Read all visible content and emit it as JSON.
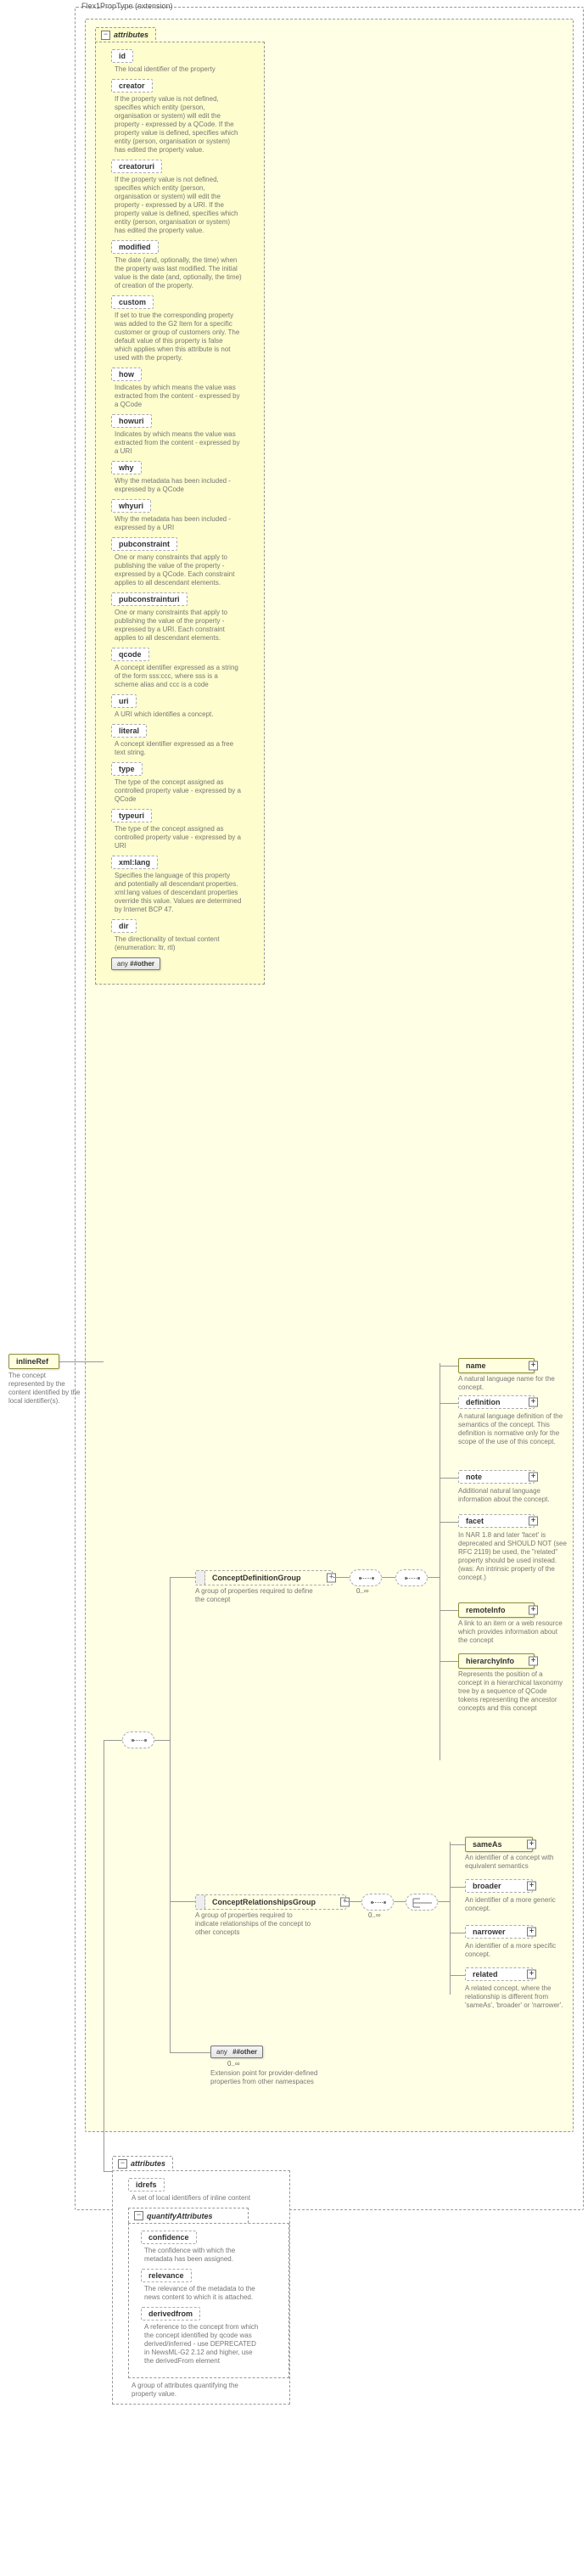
{
  "outer": {
    "extension_label": "Flex1PropType (extension)",
    "inlineRef": {
      "name": "inlineRef",
      "desc": "The concept represented by the content identified by the local identifier(s)."
    }
  },
  "attrs_main": {
    "header": "attributes",
    "items": [
      {
        "name": "id",
        "desc": "The local identifier of the property"
      },
      {
        "name": "creator",
        "desc": "If the property value is not defined, specifies which entity (person, organisation or system) will edit the property - expressed by a QCode. If the property value is defined, specifies which entity (person, organisation or system) has edited the property value."
      },
      {
        "name": "creatoruri",
        "desc": "If the property value is not defined, specifies which entity (person, organisation or system) will edit the property - expressed by a URI. If the property value is defined, specifies which entity (person, organisation or system) has edited the property value."
      },
      {
        "name": "modified",
        "desc": "The date (and, optionally, the time) when the property was last modified. The initial value is the date (and, optionally, the time) of creation of the property."
      },
      {
        "name": "custom",
        "desc": "If set to true the corresponding property was added to the G2 Item for a specific customer or group of customers only. The default value of this property is false which applies when this attribute is not used with the property."
      },
      {
        "name": "how",
        "desc": "Indicates by which means the value was extracted from the content - expressed by a QCode"
      },
      {
        "name": "howuri",
        "desc": "Indicates by which means the value was extracted from the content - expressed by a URI"
      },
      {
        "name": "why",
        "desc": "Why the metadata has been included - expressed by a QCode"
      },
      {
        "name": "whyuri",
        "desc": "Why the metadata has been included - expressed by a URI"
      },
      {
        "name": "pubconstraint",
        "desc": "One or many constraints that apply to publishing the value of the property - expressed by a QCode. Each constraint applies to all descendant elements."
      },
      {
        "name": "pubconstrainturi",
        "desc": "One or many constraints that apply to publishing the value of the property - expressed by a URI. Each constraint applies to all descendant elements."
      },
      {
        "name": "qcode",
        "desc": "A concept identifier expressed as a string of the form sss:ccc, where sss is a scheme alias and ccc is a code"
      },
      {
        "name": "uri",
        "desc": "A URI which identifies a concept."
      },
      {
        "name": "literal",
        "desc": "A concept identifier expressed as a free text string."
      },
      {
        "name": "type",
        "desc": "The type of the concept assigned as controlled property value - expressed by a QCode"
      },
      {
        "name": "typeuri",
        "desc": "The type of the concept assigned as controlled property value - expressed by a URI"
      },
      {
        "name": "xml:lang",
        "desc": "Specifies the language of this property and potentially all descendant properties. xml:lang values of descendant properties override this value. Values are determined by Internet BCP 47."
      },
      {
        "name": "dir",
        "desc": "The directionality of textual content (enumeration: ltr, rtl)"
      }
    ],
    "any_other": "##other"
  },
  "groups": {
    "cdef": {
      "name": "ConceptDefinitionGroup",
      "desc": "A group of properties required to define the concept"
    },
    "crel": {
      "name": "ConceptRelationshipsGroup",
      "desc": "A group of properties required to indicate relationships of the concept to other concepts"
    },
    "any_other": {
      "label": "##other",
      "desc": "Extension point for provider-defined properties from other namespaces",
      "occ": "0..∞"
    }
  },
  "cdef_children": [
    {
      "name": "name",
      "desc": "A natural language name for the concept."
    },
    {
      "name": "definition",
      "desc": "A natural language definition of the semantics of the concept. This definition is normative only for the scope of the use of this concept."
    },
    {
      "name": "note",
      "desc": "Additional natural language information about the concept."
    },
    {
      "name": "facet",
      "desc": "In NAR 1.8 and later 'facet' is deprecated and SHOULD NOT (see RFC 2119) be used, the \"related\" property should be used instead.(was: An intrinsic property of the concept.)"
    },
    {
      "name": "remoteInfo",
      "desc": "A link to an item or a web resource which provides information about the concept"
    },
    {
      "name": "hierarchyInfo",
      "desc": "Represents the position of a concept in a hierarchical taxonomy tree by a sequence of QCode tokens representing the ancestor concepts and this concept"
    }
  ],
  "crel_children": [
    {
      "name": "sameAs",
      "desc": "An identifier of a concept with equivalent semantics"
    },
    {
      "name": "broader",
      "desc": "An identifier of a more generic concept."
    },
    {
      "name": "narrower",
      "desc": "An identifier of a more specific concept."
    },
    {
      "name": "related",
      "desc": "A related concept, where the relationship is different from 'sameAs', 'broader' or 'narrower'."
    }
  ],
  "occ": {
    "zero_inf": "0..∞"
  },
  "attrs_lower": {
    "header": "attributes",
    "idrefs": {
      "name": "idrefs",
      "desc": "A set of local identifiers of inline content"
    },
    "quant_header": "quantifyAttributes",
    "items": [
      {
        "name": "confidence",
        "desc": "The confidence with which the metadata has been assigned."
      },
      {
        "name": "relevance",
        "desc": "The relevance of the metadata to the news content to which it is attached."
      },
      {
        "name": "derivedfrom",
        "desc": "A reference to the concept from which the concept identified by qcode was derived/inferred - use DEPRECATED in NewsML-G2 2.12 and higher, use the derivedFrom element"
      }
    ],
    "group_desc": "A group of attributes quantifying the property value."
  },
  "ui": {
    "any": "any",
    "plus": "+",
    "minus": "−"
  }
}
